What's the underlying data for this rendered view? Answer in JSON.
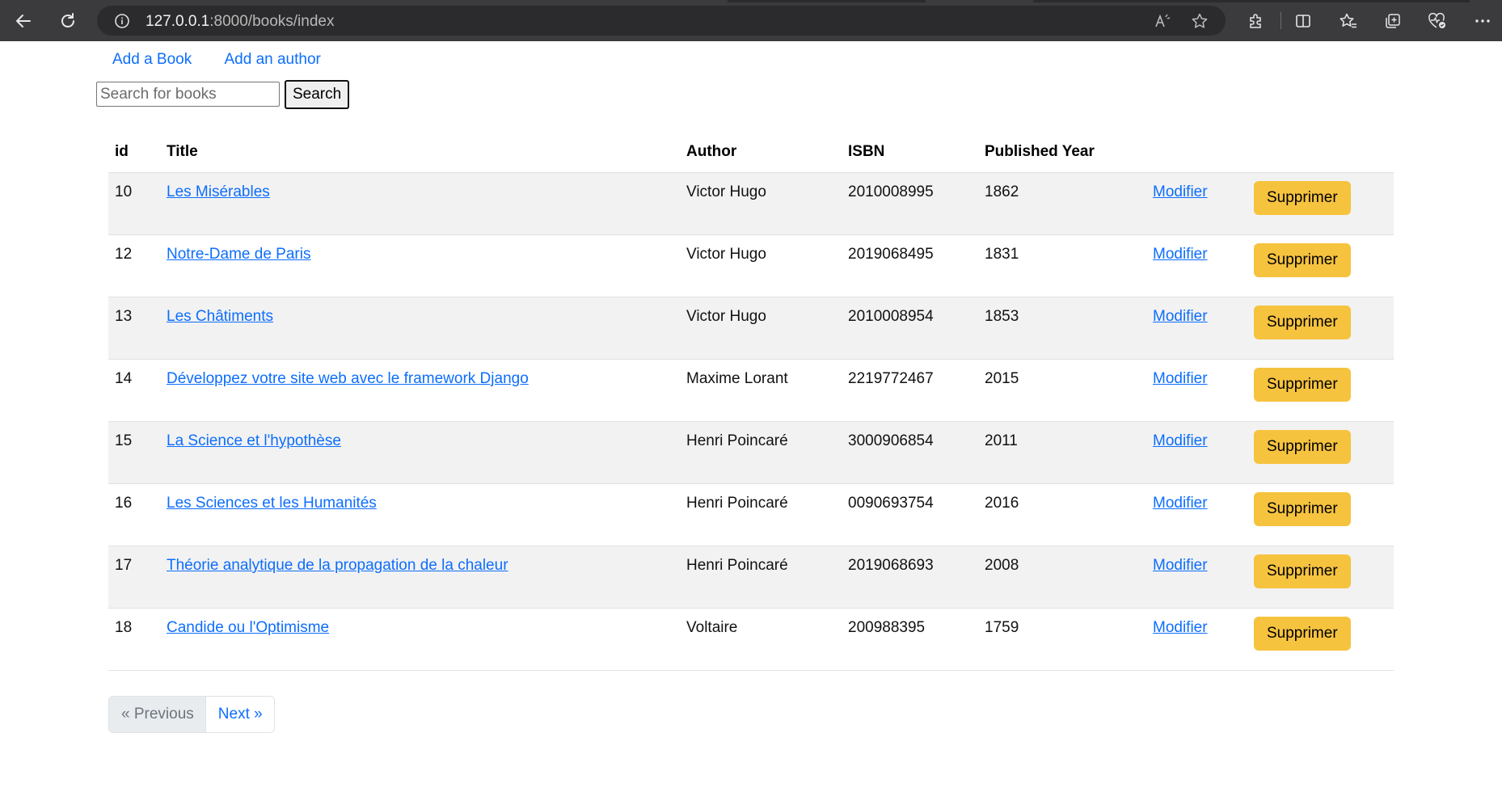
{
  "browser": {
    "url_host": "127.0.0.1",
    "url_rest": ":8000/books/index"
  },
  "nav": {
    "add_book": "Add a Book",
    "add_author": "Add an author"
  },
  "search": {
    "placeholder": "Search for books",
    "button_label": "Search"
  },
  "table": {
    "headers": [
      "id",
      "Title",
      "Author",
      "ISBN",
      "Published Year"
    ],
    "modify_label": "Modifier",
    "delete_label": "Supprimer",
    "rows": [
      {
        "id": "10",
        "title": "Les Misérables",
        "author": "Victor Hugo",
        "isbn": "2010008995",
        "year": "1862"
      },
      {
        "id": "12",
        "title": "Notre-Dame de Paris",
        "author": "Victor Hugo",
        "isbn": "2019068495",
        "year": "1831"
      },
      {
        "id": "13",
        "title": "Les Châtiments",
        "author": "Victor Hugo",
        "isbn": "2010008954",
        "year": "1853"
      },
      {
        "id": "14",
        "title": "Développez votre site web avec le framework Django",
        "author": "Maxime Lorant",
        "isbn": "2219772467",
        "year": "2015"
      },
      {
        "id": "15",
        "title": "La Science et l'hypothèse",
        "author": "Henri Poincaré",
        "isbn": "3000906854",
        "year": "2011"
      },
      {
        "id": "16",
        "title": "Les Sciences et les Humanités",
        "author": "Henri Poincaré",
        "isbn": "0090693754",
        "year": "2016"
      },
      {
        "id": "17",
        "title": "Théorie analytique de la propagation de la chaleur",
        "author": "Henri Poincaré",
        "isbn": "2019068693",
        "year": "2008"
      },
      {
        "id": "18",
        "title": "Candide ou l'Optimisme",
        "author": "Voltaire",
        "isbn": "200988395",
        "year": "1759"
      }
    ]
  },
  "pagination": {
    "previous": "« Previous",
    "next": "Next »"
  },
  "colors": {
    "link": "#0d6efd",
    "delete_button": "#f6c33f",
    "row_stripe": "#f2f2f2",
    "chrome": "#3b3b3d"
  },
  "icons": {
    "back": "back-arrow-icon",
    "reload": "reload-icon",
    "site_info": "info-icon",
    "read_aloud": "read-aloud-icon",
    "favorite": "star-icon",
    "extensions": "puzzle-icon",
    "split_screen": "split-screen-icon",
    "favorites": "favorites-icon",
    "collections": "collections-icon",
    "browser_essentials": "heart-pulse-icon",
    "more": "more-icon"
  }
}
